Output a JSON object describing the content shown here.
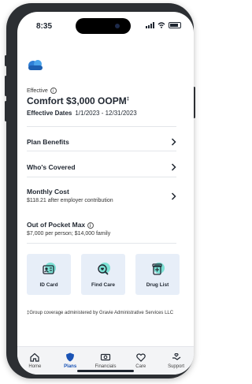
{
  "status_bar": {
    "time": "8:35"
  },
  "plan": {
    "effective_label": "Effective",
    "name": "Comfort $3,000 OOPM",
    "footnote_marker": "‡",
    "dates_label": "Effective Dates",
    "dates_value": "1/1/2023 - 12/31/2023"
  },
  "menu": [
    {
      "title": "Plan Benefits"
    },
    {
      "title": "Who's Covered"
    },
    {
      "title": "Monthly Cost",
      "subtitle": "$118.21 after employer contribution"
    },
    {
      "title": "Out of Pocket Max",
      "subtitle": "$7,000 per person; $14,000 family"
    }
  ],
  "quick_actions": [
    {
      "label": "ID Card",
      "icon": "id-card-icon"
    },
    {
      "label": "Find Care",
      "icon": "find-care-icon"
    },
    {
      "label": "Drug List",
      "icon": "drug-list-icon"
    }
  ],
  "footnote": "‡Group coverage administered by Gravie Administrative Services LLC",
  "tabbar": [
    {
      "label": "Home",
      "icon": "home-icon",
      "active": false
    },
    {
      "label": "Plans",
      "icon": "shield-icon",
      "active": true
    },
    {
      "label": "Financials",
      "icon": "money-icon",
      "active": false
    },
    {
      "label": "Care",
      "icon": "care-icon",
      "active": false
    },
    {
      "label": "Support",
      "icon": "support-icon",
      "active": false
    }
  ],
  "colors": {
    "accent": "#1a53b5",
    "card_bg": "#e7eef8",
    "highlight": "#7be0d4",
    "logo": "#2f7fd6"
  }
}
